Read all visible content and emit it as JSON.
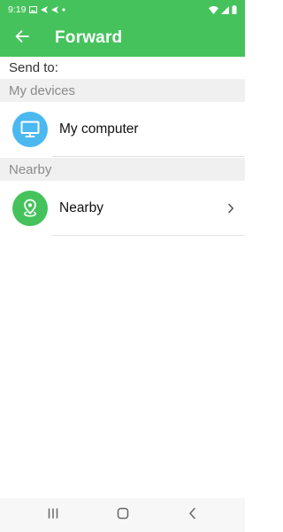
{
  "status_bar": {
    "time": "9:19",
    "left_icons": [
      "gallery-icon",
      "send-icon",
      "send-icon",
      "dot-icon"
    ],
    "right_icons": [
      "wifi-icon",
      "signal-icon",
      "battery-icon"
    ]
  },
  "app_bar": {
    "title": "Forward",
    "back_icon": "arrow-left-icon",
    "color": "#45c25c"
  },
  "send_to_label": "Send to:",
  "sections": {
    "my_devices": {
      "header": "My devices",
      "items": [
        {
          "label": "My computer",
          "icon": "monitor-icon",
          "icon_color": "#4bb8f0"
        }
      ]
    },
    "nearby": {
      "header": "Nearby",
      "items": [
        {
          "label": "Nearby",
          "icon": "location-pin-icon",
          "icon_color": "#45c25c",
          "has_chevron": true
        }
      ]
    }
  },
  "nav_bar": {
    "buttons": [
      "recents-icon",
      "home-icon",
      "back-icon"
    ]
  }
}
